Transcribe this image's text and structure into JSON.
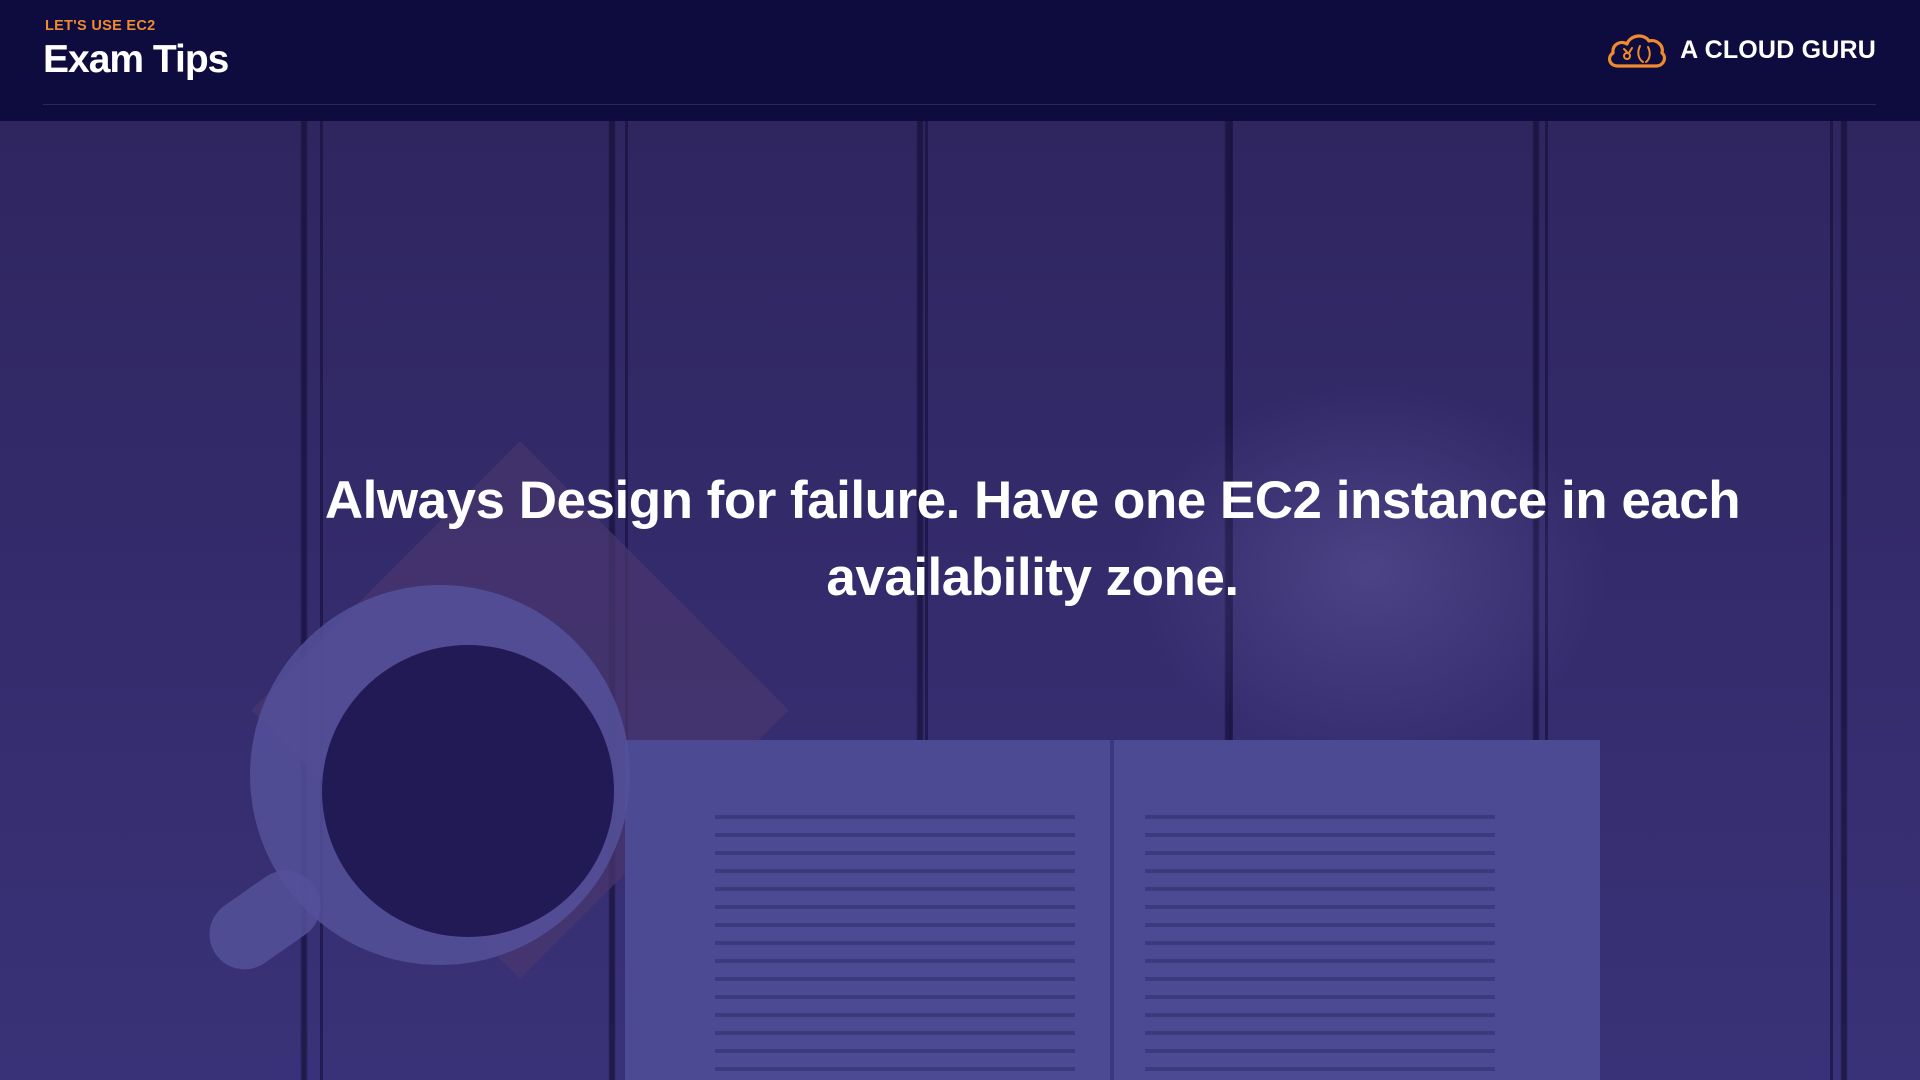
{
  "header": {
    "kicker": "LET'S USE EC2",
    "title": "Exam Tips"
  },
  "brand": {
    "name": "A CLOUD GURU",
    "icon": "cloud-icon",
    "accent_color": "#f08a2e"
  },
  "main": {
    "statement": "Always Design for failure. Have one EC2 instance in each availability zone."
  },
  "colors": {
    "header_background": "#0e0b3f",
    "overlay": "#332a6a",
    "text": "#ffffff"
  }
}
